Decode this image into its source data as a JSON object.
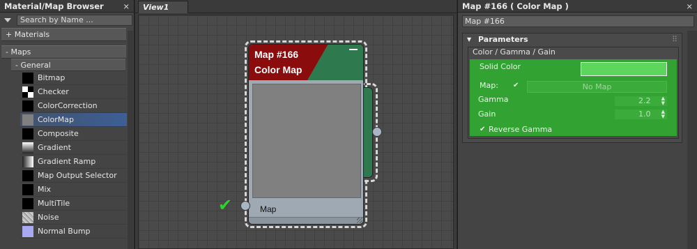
{
  "browser": {
    "title": "Material/Map Browser",
    "close_label": "×",
    "search_placeholder": "Search by Name ...",
    "categories": {
      "materials": "+ Materials",
      "maps": "- Maps"
    },
    "subcategory": "- General",
    "items": [
      {
        "label": "Bitmap",
        "swatch": "black"
      },
      {
        "label": "Checker",
        "swatch": "checker"
      },
      {
        "label": "ColorCorrection",
        "swatch": "black"
      },
      {
        "label": "ColorMap",
        "swatch": "gray",
        "selected": true
      },
      {
        "label": "Composite",
        "swatch": "black"
      },
      {
        "label": "Gradient",
        "swatch": "grad"
      },
      {
        "label": "Gradient Ramp",
        "swatch": "ramp"
      },
      {
        "label": "Map Output Selector",
        "swatch": "black"
      },
      {
        "label": "Mix",
        "swatch": "black"
      },
      {
        "label": "MultiTile",
        "swatch": "black"
      },
      {
        "label": "Noise",
        "swatch": "noise"
      },
      {
        "label": "Normal Bump",
        "swatch": "bump"
      }
    ]
  },
  "view": {
    "tab": "View1",
    "node": {
      "title": "Map #166",
      "subtitle": "Color Map",
      "port_label": "Map",
      "check": "✔"
    }
  },
  "params": {
    "title": "Map #166  ( Color Map )",
    "close_label": "×",
    "name_value": "Map #166",
    "rollout_title": "Parameters",
    "group_title": "Color / Gamma / Gain",
    "solid_color_label": "Solid Color",
    "solid_color": "#5cd65c",
    "map_label": "Map:",
    "map_button": "No Map",
    "gamma_label": "Gamma",
    "gamma_value": "2.2",
    "gain_label": "Gain",
    "gain_value": "1.0",
    "reverse_gamma_label": "Reverse Gamma",
    "check_mark": "✔"
  },
  "colors": {
    "accent_green": "#32a332",
    "node_red": "#8a0c0c",
    "node_green": "#2e7a4e",
    "selection_blue": "#3c5f96"
  }
}
